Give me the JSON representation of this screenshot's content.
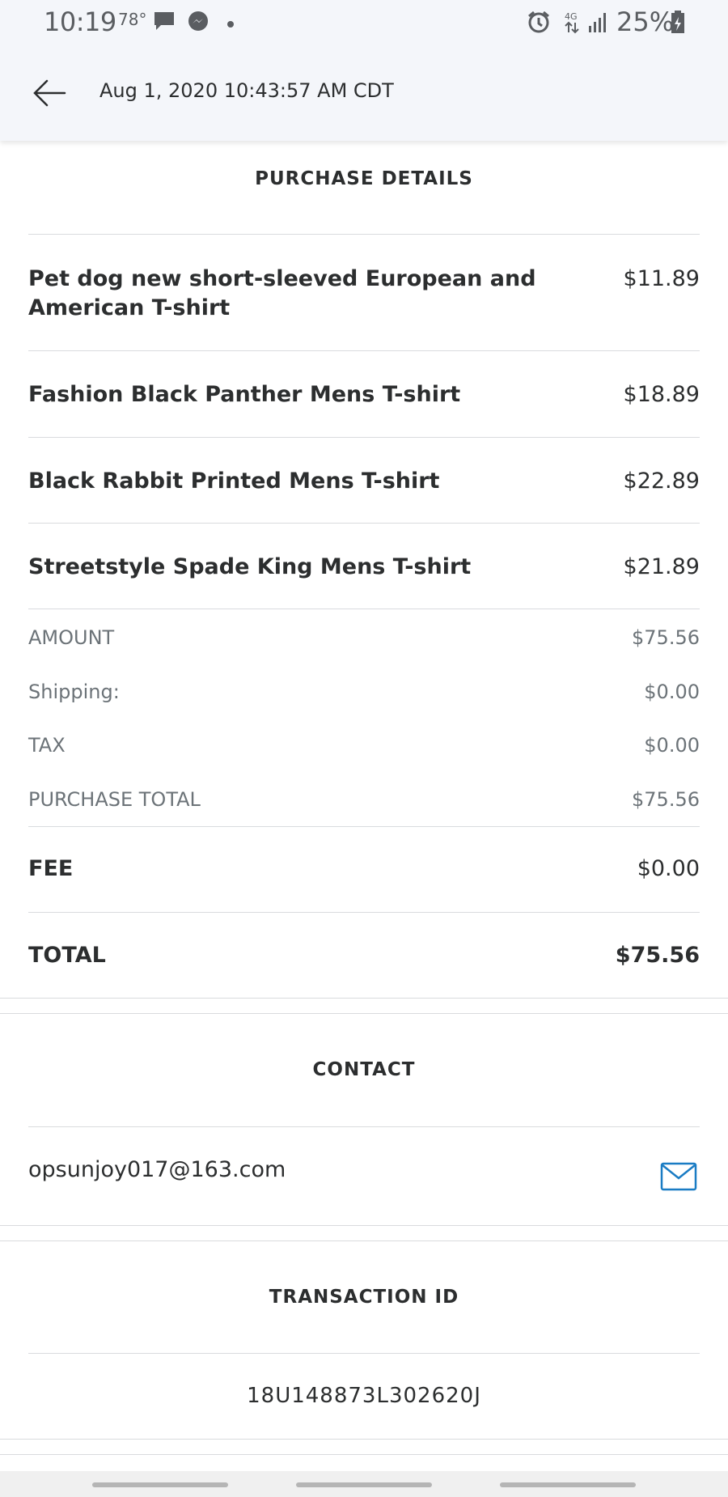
{
  "status_bar": {
    "time": "10:19",
    "temperature": "78°",
    "battery": "25%",
    "icons": [
      "message-icon",
      "messenger-icon",
      "dot-icon",
      "alarm-icon",
      "data-4g-icon",
      "signal-icon",
      "battery-charging-icon"
    ]
  },
  "header": {
    "back_icon": "arrow-left-icon",
    "datetime": "Aug 1, 2020 10:43:57 AM CDT"
  },
  "purchase": {
    "title": "PURCHASE DETAILS",
    "items": [
      {
        "name": "Pet dog new short-sleeved European and American T-shirt",
        "price": "$11.89"
      },
      {
        "name": "Fashion Black Panther Mens T-shirt",
        "price": "$18.89"
      },
      {
        "name": "Black Rabbit Printed Mens T-shirt",
        "price": "$22.89"
      },
      {
        "name": "Streetstyle Spade King Mens T-shirt",
        "price": "$21.89"
      }
    ],
    "summary": [
      {
        "label": "AMOUNT",
        "value": "$75.56"
      },
      {
        "label": "Shipping:",
        "value": "$0.00"
      },
      {
        "label": "TAX",
        "value": "$0.00"
      },
      {
        "label": "PURCHASE TOTAL",
        "value": "$75.56"
      }
    ],
    "fee": {
      "label": "FEE",
      "value": "$0.00"
    },
    "total": {
      "label": "TOTAL",
      "value": "$75.56"
    }
  },
  "contact": {
    "title": "CONTACT",
    "email": "opsunjoy017@163.com",
    "email_icon": "mail-icon"
  },
  "transaction": {
    "title": "TRANSACTION ID",
    "id": "18U148873L302620J"
  },
  "colors": {
    "header_bg": "#f4f6fa",
    "text": "#2c2e2f",
    "muted": "#6c7378",
    "accent": "#1a7cc4",
    "divider": "#d9dbde"
  }
}
